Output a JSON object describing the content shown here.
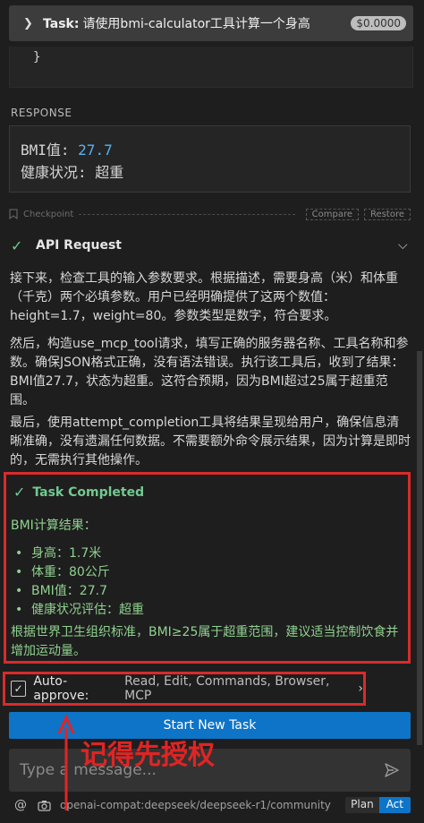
{
  "header": {
    "task_label": "Task:",
    "task_text": "请使用bmi-calculator工具计算一个身高",
    "cost": "$0.0000"
  },
  "code_snippet": {
    "text": "}"
  },
  "response": {
    "label": "RESPONSE",
    "line1_prefix": "BMI值: ",
    "line1_value": "27.7",
    "line2": "健康状况: 超重"
  },
  "checkpoint": {
    "label": "Checkpoint",
    "compare": "Compare",
    "restore": "Restore"
  },
  "api_request": {
    "title": "API Request"
  },
  "paragraphs": [
    "接下来，检查工具的输入参数要求。根据描述，需要身高（米）和体重（千克）两个必填参数。用户已经明确提供了这两个数值：height=1.7，weight=80。参数类型是数字，符合要求。",
    "然后，构造use_mcp_tool请求，填写正确的服务器名称、工具名称和参数。确保JSON格式正确，没有语法错误。执行该工具后，收到了结果：BMI值27.7，状态为超重。这符合预期，因为BMI超过25属于超重范围。",
    "最后，使用attempt_completion工具将结果呈现给用户，确保信息清晰准确，没有遗漏任何数据。不需要额外命令展示结果，因为计算是即时的，无需执行其他操作。"
  ],
  "completed": {
    "title": "Task Completed",
    "heading": "BMI计算结果：",
    "items": [
      "身高：1.7米",
      "体重：80公斤",
      "BMI值：27.7",
      "健康状况评估：超重"
    ],
    "conclusion": "根据世界卫生组织标准，BMI≥25属于超重范围，建议适当控制饮食并增加运动量。"
  },
  "auto_approve": {
    "label": "Auto-approve:",
    "items": "Read, Edit, Commands, Browser, MCP"
  },
  "start_button": "Start New Task",
  "message_input": {
    "placeholder": "Type a message..."
  },
  "bottom": {
    "at": "@",
    "model": "openai-compat:deepseek/deepseek-r1/community",
    "plan": "Plan",
    "act": "Act"
  },
  "annotation": {
    "text": "记得先授权"
  },
  "colors": {
    "accent": "#0e74c7",
    "success": "#73c991",
    "annotation_red": "#d92b2b"
  }
}
